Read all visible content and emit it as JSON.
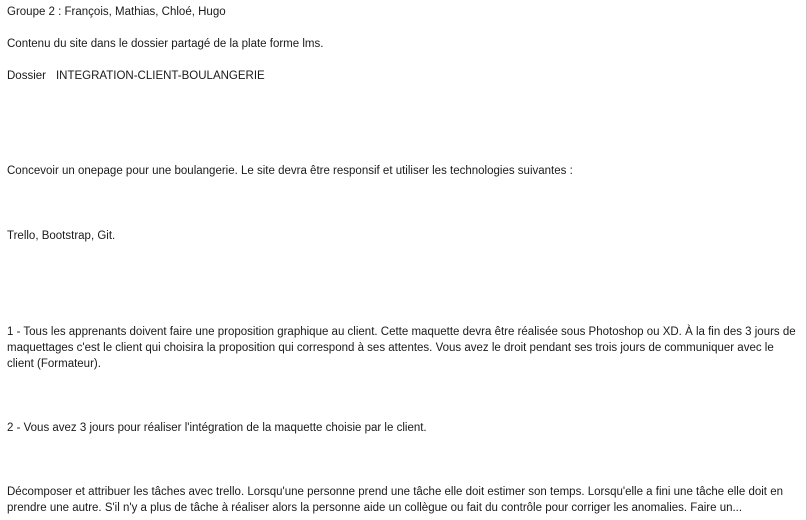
{
  "top_fragment": "ʼ",
  "group": "Groupe 2 : François, Mathias, Chloé, Hugo",
  "contenu": "Contenu du site dans le dossier partagé de la plate forme lms.",
  "dossier": {
    "label": "Dossier",
    "name": "INTEGRATION-CLIENT-BOULANGERIE"
  },
  "concevoir": "Concevoir un onepage pour une boulangerie. Le site devra être responsif et utiliser les technologies suivantes :",
  "technologies": "Trello, Bootstrap, Git.",
  "step1": "1 - Tous les apprenants doivent faire une proposition graphique au client. Cette maquette devra être réalisée sous Photoshop ou XD. À la fin des 3 jours de maquettages c'est le client qui choisira la proposition qui correspond à ses attentes. Vous avez le droit pendant ses trois jours de communiquer avec le client (Formateur).",
  "step2": "2 - Vous avez 3 jours pour réaliser l'intégration de la maquette choisie par le client.",
  "decomposer": "Décomposer et attribuer les tâches avec trello. Lorsqu'une personne prend une tâche elle doit estimer son temps. Lorsqu'elle a fini une tâche elle doit en prendre une autre. S'il n'y a plus de tâche à réaliser alors la personne aide un collègue ou fait du contrôle pour corriger les anomalies. Faire un..."
}
